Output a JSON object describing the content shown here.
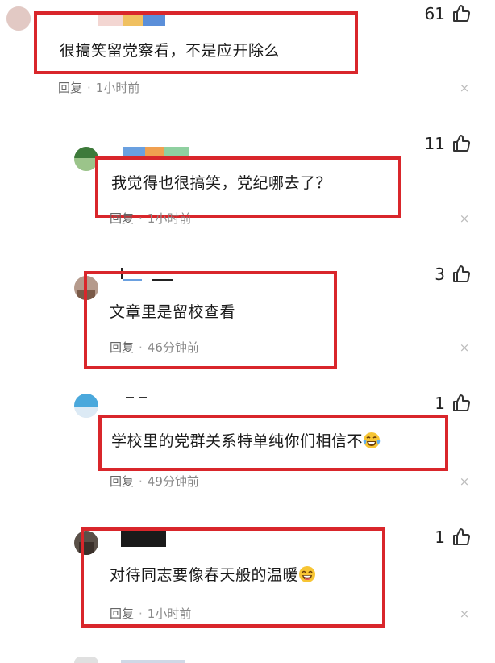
{
  "comments": [
    {
      "text": "很搞笑留党察看，不是应开除么",
      "likes": "61",
      "reply_label": "回复",
      "time": "1小时前"
    },
    {
      "text": "我觉得也很搞笑，党纪哪去了？",
      "likes": "11",
      "reply_label": "回复",
      "time": "1小时前"
    },
    {
      "text": "文章里是留校查看",
      "likes": "3",
      "reply_label": "回复",
      "time": "46分钟前"
    },
    {
      "text": "学校里的党群关系特单纯你们相信不",
      "emoji": "laughing-tears-emoji",
      "likes": "1",
      "reply_label": "回复",
      "time": "49分钟前"
    },
    {
      "text": "对待同志要像春天般的温暖",
      "emoji": "grinning-emoji",
      "likes": "1",
      "reply_label": "回复",
      "time": "1小时前"
    }
  ],
  "icons": {
    "like": "thumbs-up-icon",
    "close": "close-icon",
    "separator": "·",
    "close_glyph": "×"
  },
  "colors": {
    "highlight_box": "#d9262b",
    "meta_text": "#888888"
  }
}
